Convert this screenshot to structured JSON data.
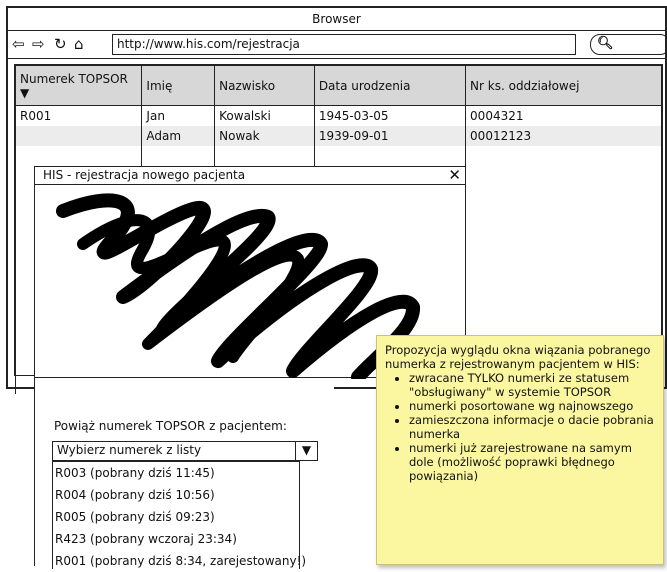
{
  "browser": {
    "title": "Browser",
    "url": "http://www.his.com/rejestracja",
    "search_icon": "magnifier-icon",
    "nav_icons": [
      "back-arrow-icon",
      "forward-arrow-icon",
      "reload-icon",
      "home-icon"
    ]
  },
  "table": {
    "headers": [
      "Numerek TOPSOR ▼",
      "Imię",
      "Nazwisko",
      "Data urodzenia",
      "Nr ks. oddziałowej"
    ],
    "rows": [
      [
        "R001",
        "Jan",
        "Kowalski",
        "1945-03-05",
        "0004321"
      ],
      [
        "",
        "Adam",
        "Nowak",
        "1939-09-01",
        "00012123"
      ]
    ]
  },
  "dialog": {
    "title": "HIS - rejestracja nowego pacjenta",
    "close": "✕",
    "link_label": "Powiąż numerek TOPSOR z pacjentem:",
    "select_value": "Wybierz numerek z listy",
    "options": [
      "R003 (pobrany dziś 11:45)",
      "R004 (pobrany dziś 10:56)",
      "R005 (pobrany dziś 09:23)",
      "R423 (pobrany wczoraj 23:34)",
      "R001 (pobrany dziś 8:34, zarejestowany!)"
    ]
  },
  "note": {
    "intro": "Propozycja wyglądu okna wiązania pobranego numerka z rejestrowanym pacjentem w HIS:",
    "points": [
      "zwracane TYLKO numerki ze statusem \"obsługiwany\" w systemie TOPSOR",
      "numerki posortowane wg najnowszego",
      "zamieszczona informacje o dacie pobrania numerka",
      "numerki już zarejestrowane na samym dole (możliwość poprawki błędnego powiązania)"
    ],
    "color": "#fbf7a0"
  }
}
